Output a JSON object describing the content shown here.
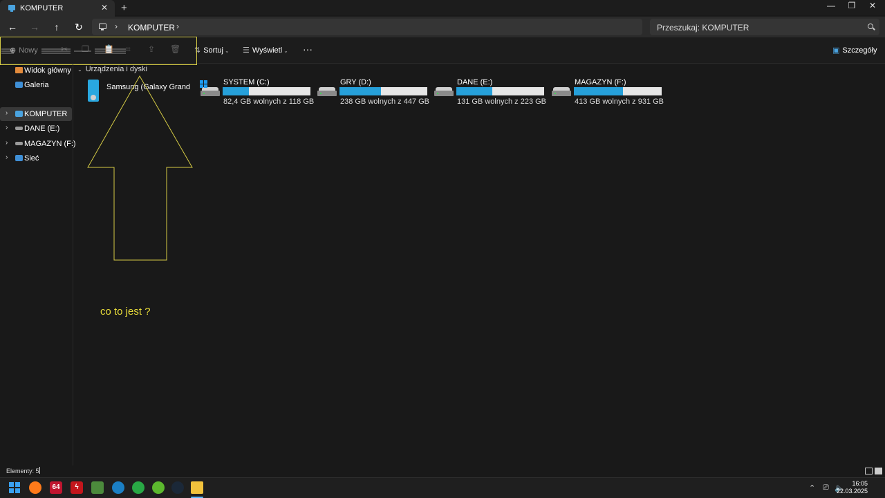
{
  "window": {
    "tab_title": "KOMPUTER",
    "close_tab": "✕",
    "new_tab": "+",
    "controls": {
      "minimize": "—",
      "maximize": "❐",
      "close": "✕"
    }
  },
  "nav": {
    "back": "←",
    "forward": "→",
    "up": "↑",
    "refresh": "↻",
    "breadcrumb_sep": "›",
    "breadcrumb": "KOMPUTER",
    "search_placeholder": "Przeszukaj: KOMPUTER"
  },
  "commandbar": {
    "new_label": "Nowy",
    "sort_label": "Sortuj",
    "view_label": "Wyświetl",
    "more": "···",
    "details_label": "Szczegóły"
  },
  "sidebar": {
    "items": [
      {
        "label": "Widok główny",
        "icon": "home-icon"
      },
      {
        "label": "Galeria",
        "icon": "gallery-icon"
      },
      {
        "label": "KOMPUTER",
        "icon": "computer-icon",
        "selected": true
      },
      {
        "label": "DANE (E:)",
        "icon": "drive-icon"
      },
      {
        "label": "MAGAZYN (F:)",
        "icon": "drive-icon"
      },
      {
        "label": "Sieć",
        "icon": "network-icon"
      }
    ]
  },
  "content": {
    "section_title": "Urządzenia i dyski",
    "device": {
      "label": "Samsung (Galaxy Grand",
      "icon": "phone-icon"
    },
    "drives": [
      {
        "name": "SYSTEM (C:)",
        "free": "82,4 GB wolnych z 118 GB",
        "used_fraction": 0.3,
        "icon": "system-drive-icon"
      },
      {
        "name": "GRY (D:)",
        "free": "238 GB wolnych z 447 GB",
        "used_fraction": 0.47,
        "icon": "drive-icon"
      },
      {
        "name": "DANE (E:)",
        "free": "131 GB wolnych z 223 GB",
        "used_fraction": 0.41,
        "icon": "drive-icon"
      },
      {
        "name": "MAGAZYN (F:)",
        "free": "413 GB wolnych z 931 GB",
        "used_fraction": 0.56,
        "icon": "drive-icon"
      }
    ]
  },
  "annotation": {
    "text": "co to jest ?",
    "color": "#e8dc3a"
  },
  "status": {
    "items_count": "Elementy: 5"
  },
  "taskbar": {
    "apps": [
      {
        "icon": "windows-start-icon",
        "label": ""
      },
      {
        "icon": "firefox-icon",
        "label": ""
      },
      {
        "icon": "aida64-icon",
        "label": "64"
      },
      {
        "icon": "flash-icon",
        "label": "ϟ"
      },
      {
        "icon": "gpu-tool-icon",
        "label": ""
      },
      {
        "icon": "blue-app-icon",
        "label": ""
      },
      {
        "icon": "green-app-icon",
        "label": ""
      },
      {
        "icon": "green-app-icon-2",
        "label": ""
      },
      {
        "icon": "steam-icon",
        "label": ""
      },
      {
        "icon": "file-explorer-icon",
        "label": ""
      }
    ],
    "time": "16:05",
    "date": "22.03.2025"
  },
  "colors": {
    "accent": "#26a0da",
    "annotation": "#e8dc3a",
    "background": "#191919"
  }
}
